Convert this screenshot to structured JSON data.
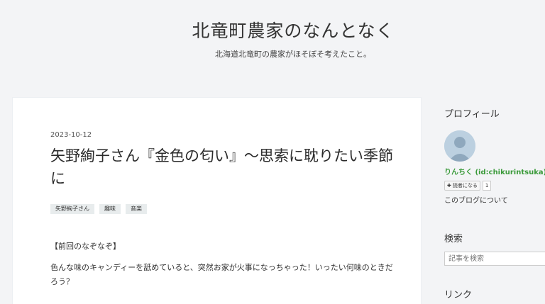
{
  "blog": {
    "title": "北竜町農家のなんとなく",
    "description": "北海道北竜町の農家がほそぼそ考えたこと。"
  },
  "entry": {
    "date": "2023-10-12",
    "title": "矢野絢子さん『金色の匂い』〜思索に耽りたい季節に",
    "categories": [
      "矢野絢子さん",
      "趣味",
      "音楽"
    ],
    "body_heading": "【前回のなぞなぞ】",
    "body_paragraph": "色んな味のキャンディーを舐めていると、突然お家が火事になっちゃった！いったい何味のときだろう？"
  },
  "sidebar": {
    "profile_title": "プロフィール",
    "profile_name": "りんちく (id:chikurintsuka)",
    "reader_button": "読者になる",
    "reader_count": "1",
    "about_link": "このブログについて",
    "search_title": "検索",
    "search_placeholder": "記事を検索",
    "link_title": "リンク"
  },
  "colors": {
    "background": "#f3f4f6",
    "card": "#ffffff",
    "profile_name": "#3a9a3a",
    "tag_background": "#e8eced"
  },
  "icons": {
    "avatar": "default-user-avatar-icon",
    "reader_plus": "plus-icon"
  }
}
